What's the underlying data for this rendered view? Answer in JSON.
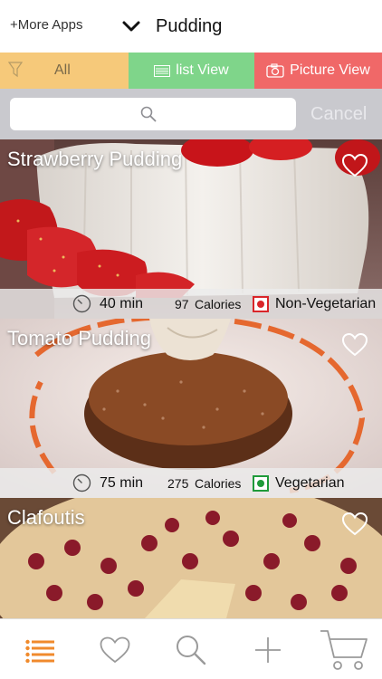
{
  "header": {
    "more_apps": "+More Apps",
    "title": "Pudding"
  },
  "filters": {
    "all": "All",
    "list_view": "list View",
    "picture_view": "Picture View"
  },
  "search": {
    "placeholder": "",
    "cancel": "Cancel"
  },
  "recipes": [
    {
      "name": "Strawberry Pudding",
      "time": "40 min",
      "calories": "97",
      "calories_label": "Calories",
      "diet": "Non-Vegetarian",
      "diet_color": "#d9262a"
    },
    {
      "name": "Tomato Pudding",
      "time": "75 min",
      "calories": "275",
      "calories_label": "Calories",
      "diet": "Vegetarian",
      "diet_color": "#1f9a3a"
    },
    {
      "name": "Clafoutis"
    }
  ],
  "tabbar": {
    "icons": [
      "list-icon",
      "heart-icon",
      "search-icon",
      "plus-icon",
      "cart-icon"
    ],
    "active_color": "#f08a2c"
  }
}
